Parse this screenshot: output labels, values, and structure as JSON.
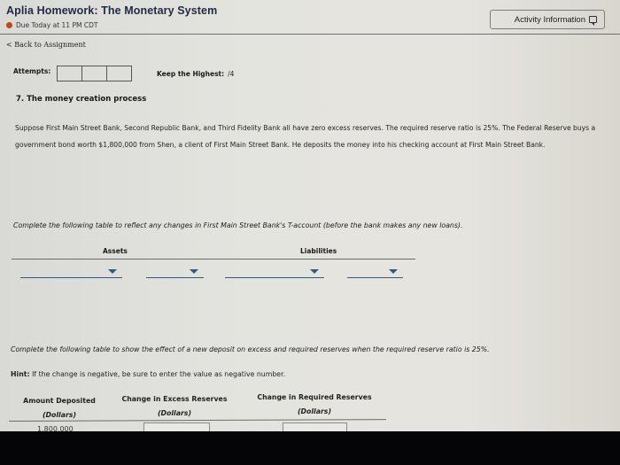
{
  "header": {
    "title": "Aplia Homework: The Monetary System",
    "due": "Due Today at 11 PM CDT",
    "due_color": "#c2451c",
    "activity_button": "Activity Information",
    "activity_icon": "chat-bubble-icon"
  },
  "nav": {
    "back_link": "< Back to Assignment"
  },
  "attempts": {
    "label": "Attempts:",
    "boxes": [
      "",
      "",
      ""
    ],
    "keep_label": "Keep the Highest:",
    "keep_value": "/4"
  },
  "question": {
    "title": "7. The money creation process",
    "paragraph": "Suppose First Main Street Bank, Second Republic Bank, and Third Fidelity Bank all have zero excess reserves. The required reserve ratio is 25%. The Federal Reserve buys a government bond worth $1,800,000 from Shen, a client of First Main Street Bank. He deposits the money into his checking account at First Main Street Bank."
  },
  "t_account": {
    "instruction": "Complete the following table to reflect any changes in First Main Street Bank's T-account (before the bank makes any new loans).",
    "assets_header": "Assets",
    "liabilities_header": "Liabilities",
    "dropdowns": [
      {
        "name": "assets-item-dropdown",
        "value": ""
      },
      {
        "name": "assets-amount-dropdown",
        "value": ""
      },
      {
        "name": "liabilities-item-dropdown",
        "value": ""
      },
      {
        "name": "liabilities-amount-dropdown",
        "value": ""
      }
    ],
    "accent_color": "#2f5a86"
  },
  "reserves_table": {
    "instruction": "Complete the following table to show the effect of a new deposit on excess and required reserves when the required reserve ratio is 25%.",
    "hint_label": "Hint:",
    "hint_text": " If the change is negative, be sure to enter the value as negative number.",
    "columns": [
      {
        "title": "Amount Deposited",
        "unit": "(Dollars)"
      },
      {
        "title": "Change in Excess Reserves",
        "unit": "(Dollars)"
      },
      {
        "title": "Change in Required Reserves",
        "unit": "(Dollars)"
      }
    ],
    "rows": [
      {
        "amount": "1,800,000",
        "excess": "",
        "required": ""
      }
    ]
  }
}
